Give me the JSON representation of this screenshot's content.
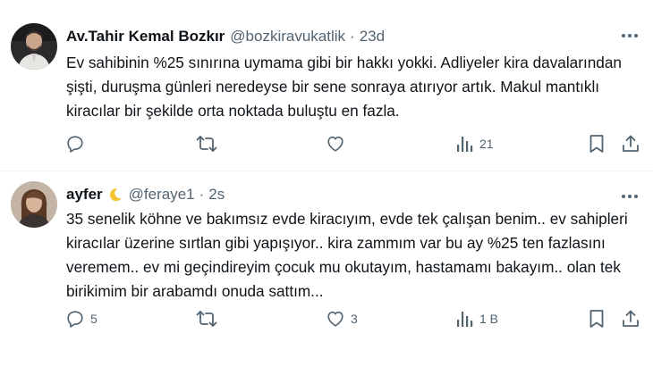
{
  "tweets": [
    {
      "name": "Av.Tahir Kemal Bozkır",
      "handle": "@bozkiravukatlik",
      "dot": "·",
      "time": "23d",
      "text": "Ev sahibinin %25 sınırına uymama gibi bir hakkı yokki. Adliyeler kira davalarından şişti, duruşma günleri neredeyse bir sene sonraya atırıyor artık. Makul mantıklı kiracılar bir şekilde orta noktada buluştu en fazla.",
      "replies": "",
      "retweets": "",
      "likes": "",
      "views": "21"
    },
    {
      "name": "ayfer",
      "emoji": "crescent-moon-icon",
      "handle": "@feraye1",
      "dot": "·",
      "time": "2s",
      "text": "35 senelik köhne ve bakımsız evde kiracıyım, evde tek çalışan benim.. ev sahipleri kiracılar üzerine sırtlan gibi yapışıyor.. kira zammım var bu ay %25 ten fazlasını veremem.. ev mi geçindireyim çocuk mu okutayım, hastamamı bakayım.. olan tek birikimim bir arabamdı onuda sattım...",
      "replies": "5",
      "retweets": "",
      "likes": "3",
      "views": "1 B"
    }
  ],
  "colors": {
    "text": "#0f1419",
    "secondary": "#536471",
    "separator": "#eff3f4",
    "moon": "#f4c430"
  }
}
